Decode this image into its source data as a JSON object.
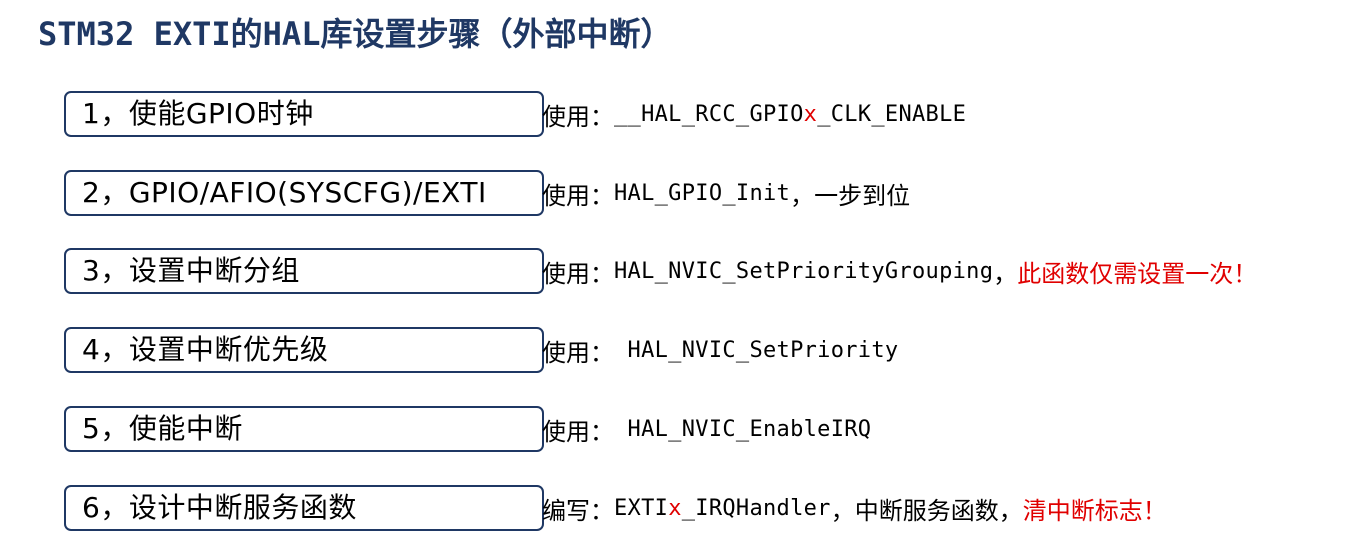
{
  "title": "STM32 EXTI的HAL库设置步骤（外部中断）",
  "steps": [
    {
      "label": "1，使能GPIO时钟",
      "prefix": "使用：",
      "code_a": "__HAL_RCC_GPIO",
      "code_x": "x",
      "code_b": "_CLK_ENABLE"
    },
    {
      "label": "2，GPIO/AFIO(SYSCFG)/EXTI",
      "prefix": "使用：",
      "code": "HAL_GPIO_Init",
      "suffix": "，一步到位"
    },
    {
      "label": "3，设置中断分组",
      "prefix": "使用：",
      "code": "HAL_NVIC_SetPriorityGrouping",
      "suffix": "，",
      "note": "此函数仅需设置一次！"
    },
    {
      "label": "4，设置中断优先级",
      "prefix": "使用：",
      "code": " HAL_NVIC_SetPriority"
    },
    {
      "label": "5，使能中断",
      "prefix": "使用：",
      "code": " HAL_NVIC_EnableIRQ"
    },
    {
      "label": "6，设计中断服务函数",
      "prefix": "编写：",
      "code_a": "EXTI",
      "code_x": "x",
      "code_b": "_IRQHandler",
      "suffix": "，中断服务函数，",
      "note": "清中断标志！"
    }
  ],
  "colors": {
    "title": "#1f3864",
    "box_border": "#1f3864",
    "highlight": "#e00000"
  }
}
